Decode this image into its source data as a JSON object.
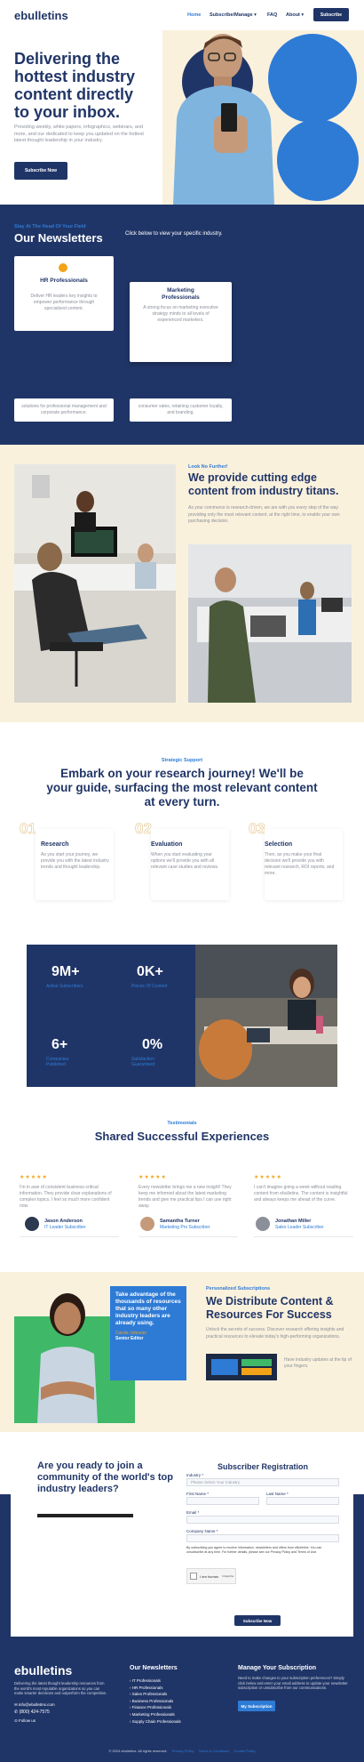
{
  "header": {
    "logo": "ebulletins",
    "nav": [
      "Home",
      "Subscribe/Manage",
      "FAQ",
      "About"
    ],
    "nav_subscribe_arrow": "▾",
    "nav_about_arrow": "▾",
    "cta": "Subscribe"
  },
  "hero": {
    "title": "Delivering the hottest industry content directly to your inbox.",
    "body": "Providing weekly, white papers, infographics, webinars, and more, and our dedicated to keep you updated on the hottest latest thought leadership in your industry.",
    "button": "Subscribe Now"
  },
  "newsletters": {
    "kicker": "Stay At The Head Of Your Field",
    "title": "Our Newsletters",
    "instruction": "Click below to view your specific industry.",
    "cards": [
      {
        "title": "HR Professionals",
        "desc": "Deliver HR leaders key insights to empower performance through specialized content."
      },
      {
        "title": "Marketing Professionals",
        "desc": "A strong focus on marketing executive strategy minds to all levels of experienced marketers."
      }
    ],
    "lower_cards": [
      {
        "desc": "solutions for professional management and corporate performance."
      },
      {
        "desc": "consumer sales, retaining customer loyalty, and branding."
      }
    ]
  },
  "cutting": {
    "kicker": "Look No Further!",
    "title": "We provide cutting edge content from industry titans.",
    "body": "As your commerce is research-driven, we are with you every step of the way providing only the most relevant content, at the right time, to enable your own purchasing decision."
  },
  "journey": {
    "kicker": "Strategic Support",
    "title": "Embark on your research journey! We'll be your guide, surfacing the most relevant content at every turn.",
    "steps": [
      {
        "num": "01",
        "title": "Research",
        "desc": "As you start your journey, we provide you with the latest industry trends and thought leadership."
      },
      {
        "num": "02",
        "title": "Evaluation",
        "desc": "When you start evaluating your options we'll provide you with all relevant case studies and reviews."
      },
      {
        "num": "03",
        "title": "Selection",
        "desc": "Then, as you make your final decision we'll provide you with relevant research, ROI reports, and more."
      }
    ]
  },
  "stats": [
    {
      "value": "9M+",
      "label": "Active Subscribers"
    },
    {
      "value": "0K+",
      "label": "Pieces Of Content"
    },
    {
      "value": "6+",
      "label": "Companies Published"
    },
    {
      "value": "0%",
      "label": "Satisfaction Guaranteed"
    }
  ],
  "testimonials": {
    "kicker": "Testimonials",
    "title": "Shared Successful Experiences",
    "items": [
      {
        "stars": "★★★★★",
        "quote": "I'm in awe of consistent business-critical information. They provide clear explanations of complex topics. I feel so much more confident now.",
        "name": "Jason Anderson",
        "role": "IT Leader Subscriber"
      },
      {
        "stars": "★★★★★",
        "quote": "Every newsletter brings me a new insight! They keep me informed about the latest marketing trends and give me practical tips I can use right away.",
        "name": "Samantha Turner",
        "role": "Marketing Pro Subscriber"
      },
      {
        "stars": "★★★★★",
        "quote": "I can't imagine going a week without reading content from ebulletins. The content is insightful and always keeps me ahead of the curve.",
        "name": "Jonathan Miller",
        "role": "Sales Leader Subscriber"
      }
    ]
  },
  "distribute": {
    "callout": "Take advantage of the thousands of resources that so many other industry leaders are already using.",
    "callout_name": "Carole Johnson",
    "callout_role": "Senior Editor",
    "kicker": "Personalized Subscriptions",
    "title": "We Distribute Content & Resources For Success",
    "body": "Unlock the secrets of success. Discover research offering insights and practical resources to elevate today's high-performing organizations.",
    "thumb_caption": "Have industry updates at the tip of your fingers."
  },
  "register": {
    "title": "Are you ready to join a community of the world's top industry leaders?",
    "form_title": "Subscriber Registration",
    "fields": {
      "industry": "Industry *",
      "industry_placeholder": "Please Select Your Industry",
      "first": "First Name *",
      "last": "Last Name *",
      "email": "Email *",
      "company": "Company Name *"
    },
    "legal": "By subscribing you agree to receive information, newsletters and offers from eBulletins. You can unsubscribe at any time. For further details, please see our Privacy Policy and Terms of Use.",
    "captcha": "I am human",
    "captcha_brand": "hCaptcha",
    "submit": "Subscribe Now"
  },
  "footer": {
    "logo": "ebulletins",
    "about": "Delivering the latest thought leadership resources from the world's most reputable organizations so you can make smarter decisions and outperform the competition.",
    "email": "info@ebulletins.com",
    "phone": "(800) 424-7575",
    "follow": "Follow us",
    "newsletters_title": "Our Newsletters",
    "newsletters": [
      "IT Professionals",
      "HR Professionals",
      "Sales Professionals",
      "Business Professionals",
      "Finance Professionals",
      "Marketing Professionals",
      "Supply Chain Professionals"
    ],
    "manage_title": "Manage Your Subscription",
    "manage_body": "Need to make changes to your subscription preferences? Simply click below and enter your email address to update your newsletter subscription or unsubscribe from our communications.",
    "manage_button": "My Subscription",
    "copyright": "© 2024 ebulletins. All rights reserved.",
    "privacy": "Privacy Policy",
    "terms": "Terms & Conditions",
    "cookie": "Cookie Policy"
  },
  "colors": {
    "navy": "#203567",
    "accent_blue": "#2e7bd6",
    "orange": "#f2a31a",
    "cream": "#faf1dd",
    "green": "#3fb868"
  }
}
